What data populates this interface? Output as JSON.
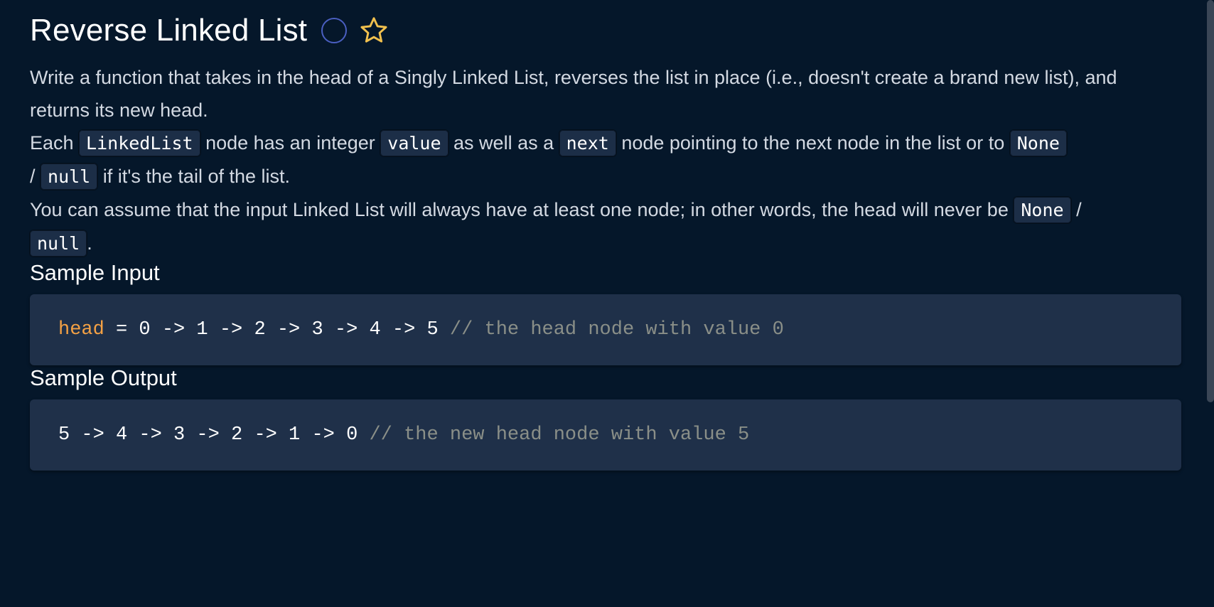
{
  "problem": {
    "title": "Reverse Linked List",
    "status_icon": "circle-outline-icon",
    "favorite_icon": "star-outline-icon"
  },
  "description": {
    "p1": "Write a function that takes in the head of a Singly Linked List, reverses the list in place (i.e., doesn't create a brand new list), and returns its new head.",
    "p2": {
      "t1": "Each ",
      "c1": "LinkedList",
      "t2": " node has an integer ",
      "c2": "value",
      "t3": " as well as a ",
      "c3": "next",
      "t4": " node pointing to the next node in the list or to ",
      "c4": "None",
      "t5": " / ",
      "c5": "null",
      "t6": " if it's the tail of the list."
    },
    "p3": {
      "t1": "You can assume that the input Linked List will always have at least one node; in other words, the head will never be ",
      "c1": "None",
      "t2": " / ",
      "c2": "null",
      "t3": "."
    }
  },
  "sample_input": {
    "heading": "Sample Input",
    "keyword": "head",
    "code": " = 0 -> 1 -> 2 -> 3 -> 4 -> 5 ",
    "comment": "// the head node with value 0"
  },
  "sample_output": {
    "heading": "Sample Output",
    "code": "5 -> 4 -> 3 -> 2 -> 1 -> 0 ",
    "comment": "// the new head node with value 5"
  },
  "colors": {
    "background": "#05172a",
    "code_background": "#1f3049",
    "keyword": "#f4a144",
    "comment": "#8a8f88",
    "status_circle": "#4a5fc1",
    "star": "#f2c14e"
  }
}
